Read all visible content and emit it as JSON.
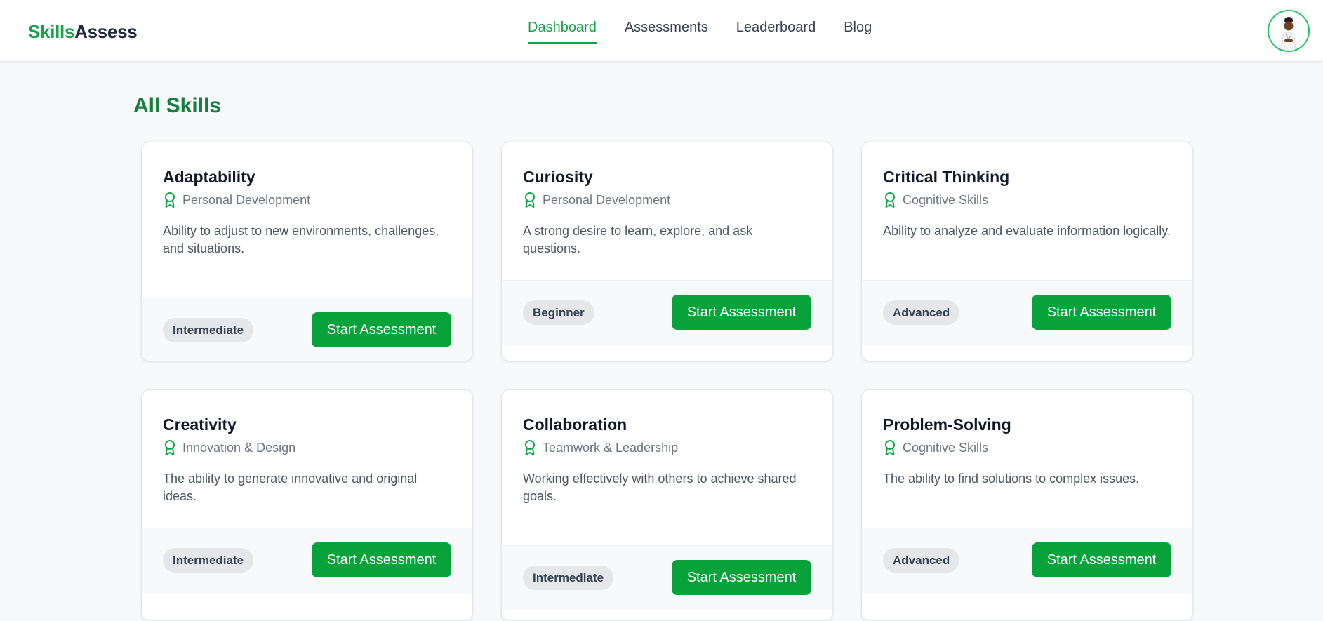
{
  "header": {
    "logo_part1": "Skills",
    "logo_part2": "Assess",
    "nav": [
      "Dashboard",
      "Assessments",
      "Leaderboard",
      "Blog"
    ]
  },
  "section": {
    "title": "All Skills"
  },
  "colors": {
    "brand": "#16a34a",
    "button": "#07a33a",
    "badge": "#e5e7eb"
  },
  "skills": [
    {
      "title": "Adaptability",
      "category": "Personal Development",
      "description": "Ability to adjust to new environments, challenges, and situations.",
      "level": "Intermediate",
      "button": "Start Assessment",
      "icon": "award-icon"
    },
    {
      "title": "Curiosity",
      "category": "Personal Development",
      "description": "A strong desire to learn, explore, and ask questions.",
      "level": "Beginner",
      "button": "Start Assessment",
      "icon": "award-icon"
    },
    {
      "title": "Critical Thinking",
      "category": "Cognitive Skills",
      "description": "Ability to analyze and evaluate information logically.",
      "level": "Advanced",
      "button": "Start Assessment",
      "icon": "award-icon"
    },
    {
      "title": "Creativity",
      "category": "Innovation & Design",
      "description": "The ability to generate innovative and original ideas.",
      "level": "Intermediate",
      "button": "Start Assessment",
      "icon": "award-icon"
    },
    {
      "title": "Collaboration",
      "category": "Teamwork & Leadership",
      "description": "Working effectively with others to achieve shared goals.",
      "level": "Intermediate",
      "button": "Start Assessment",
      "icon": "award-icon"
    },
    {
      "title": "Problem-Solving",
      "category": "Cognitive Skills",
      "description": "The ability to find solutions to complex issues.",
      "level": "Advanced",
      "button": "Start Assessment",
      "icon": "award-icon"
    }
  ]
}
